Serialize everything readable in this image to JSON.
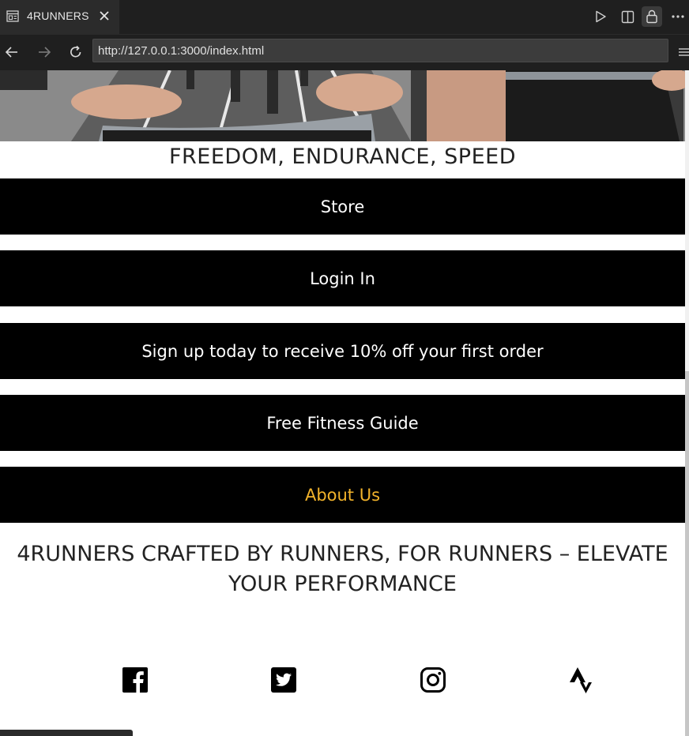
{
  "browser": {
    "tab_title": "4RUNNERS",
    "url": "http://127.0.0.1:3000/index.html"
  },
  "page": {
    "tagline": "FREEDOM, ENDURANCE, SPEED",
    "nav": [
      "Store",
      "Login In",
      "Sign up today to receive 10% off your first order",
      "Free Fitness Guide",
      "About Us"
    ],
    "active_nav": "About Us",
    "accent_color": "#f2b32b",
    "mission": "4RUNNERS CRAFTED BY RUNNERS, FOR RUNNERS – ELEVATE YOUR PERFORMANCE",
    "social_icons": [
      "facebook-icon",
      "twitter-icon",
      "instagram-icon",
      "strava-icon"
    ]
  }
}
